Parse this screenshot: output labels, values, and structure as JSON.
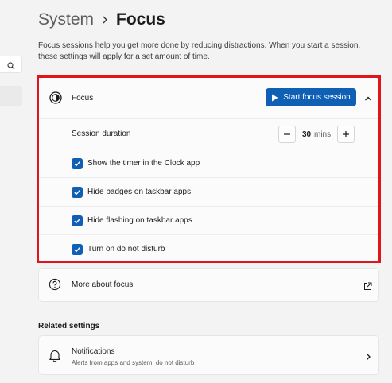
{
  "breadcrumb": {
    "parent": "System",
    "current": "Focus"
  },
  "intro": "Focus sessions help you get more done by reducing distractions. When you start a session, these settings will apply for a set amount of time.",
  "focus": {
    "title": "Focus",
    "start_button": "Start focus session",
    "session_duration_label": "Session duration",
    "session_duration_value": "30",
    "session_duration_unit": "mins",
    "options": [
      {
        "label": "Show the timer in the Clock app",
        "checked": true
      },
      {
        "label": "Hide badges on taskbar apps",
        "checked": true
      },
      {
        "label": "Hide flashing on taskbar apps",
        "checked": true
      },
      {
        "label": "Turn on do not disturb",
        "checked": true
      }
    ]
  },
  "more_about": {
    "label": "More about focus"
  },
  "related_settings": {
    "heading": "Related settings",
    "notifications": {
      "title": "Notifications",
      "subtitle": "Alerts from apps and system, do not disturb"
    }
  },
  "colors": {
    "accent": "#0f5fb4",
    "highlight": "#e0141b"
  }
}
